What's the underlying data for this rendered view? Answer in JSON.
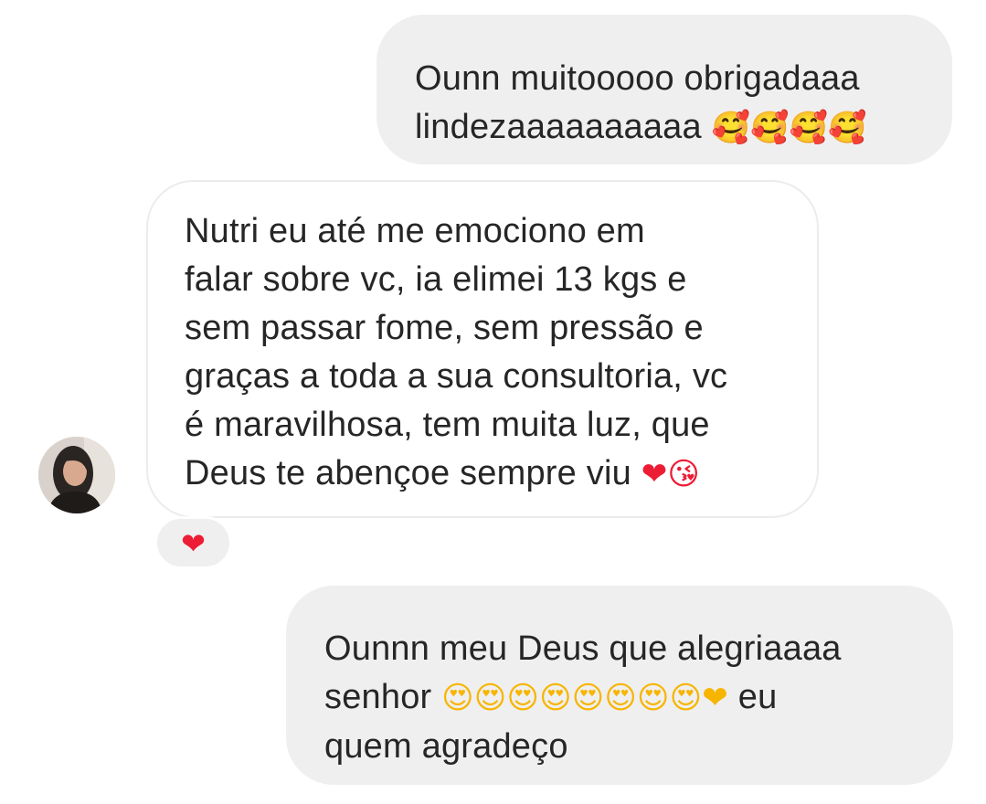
{
  "messages": [
    {
      "id": "msg1",
      "direction": "sent",
      "lines": [
        "Ounn muitooooo obrigadaaa",
        "lindezaaaaaaaaaa"
      ],
      "emojis": "🥰🥰🥰🥰"
    },
    {
      "id": "msg2",
      "direction": "received",
      "lines": [
        "Nutri eu até me emociono em",
        "falar sobre vc, ia elimei 13 kgs e",
        "sem passar fome, sem pressão e",
        "graças a toda a sua consultoria, vc",
        "é maravilhosa, tem muita luz, que",
        "Deus te abençoe sempre viu"
      ],
      "emojis": "❤😘",
      "reaction": "❤"
    },
    {
      "id": "msg3",
      "direction": "sent",
      "lines": [
        "Ounnn meu Deus que alegriaaaa",
        "senhor",
        "eu",
        "quem agradeço"
      ],
      "emojis": "😍😍😍😍😍😍😍😍❤"
    }
  ],
  "colors": {
    "sent_bubble": "#efefef",
    "received_bubble_border": "#ececec",
    "text": "#262626",
    "heart": "#ed1c35"
  },
  "icons": {
    "avatar": "user-avatar",
    "reaction": "red-heart-icon"
  }
}
